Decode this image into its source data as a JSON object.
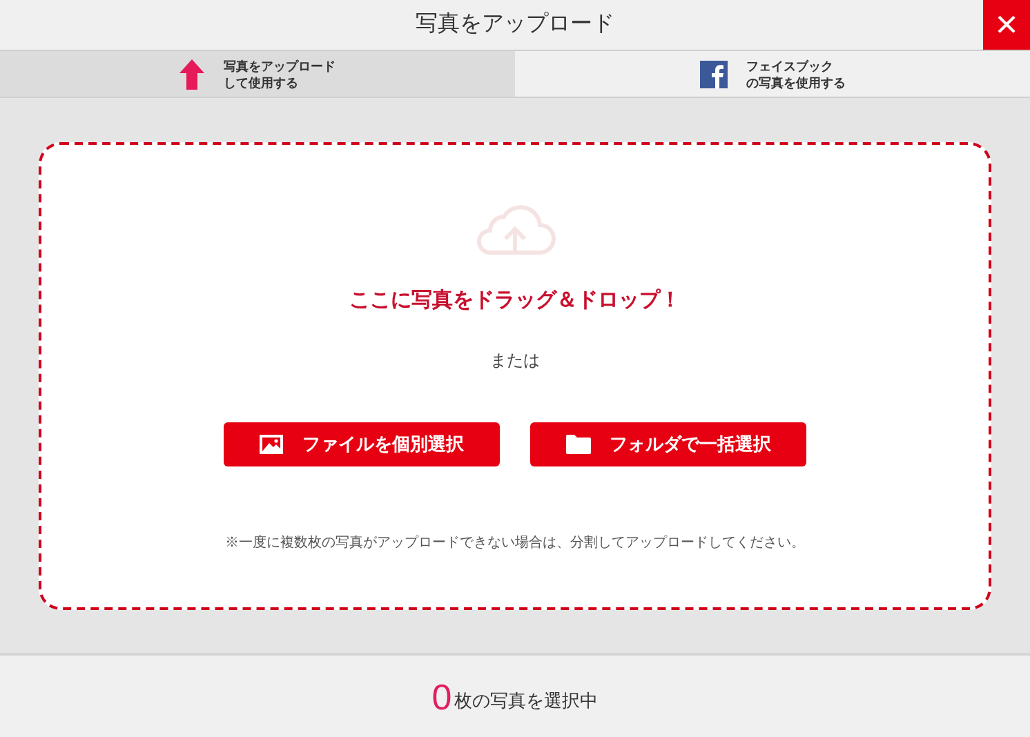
{
  "window": {
    "title": "写真をアップロード",
    "close": "×"
  },
  "tabs": [
    {
      "kind": "upload",
      "lines": [
        "写真をアップロード",
        "して使用する"
      ],
      "selected": true
    },
    {
      "kind": "facebook",
      "lines": [
        "フェイスブック",
        "の写真を使用する"
      ],
      "selected": false
    }
  ],
  "dropzone": {
    "heading": "ここに写真をドラッグ＆ドロップ！",
    "or": "または",
    "buttons": [
      {
        "kind": "image",
        "label": "ファイルを個別選択"
      },
      {
        "kind": "folder",
        "label": "フォルダで一括選択"
      }
    ],
    "note": "※一度に複数枚の写真がアップロードできない場合は、分割してアップロードしてください。"
  },
  "footer": {
    "count": "0",
    "text": "枚の写真を選択中"
  }
}
